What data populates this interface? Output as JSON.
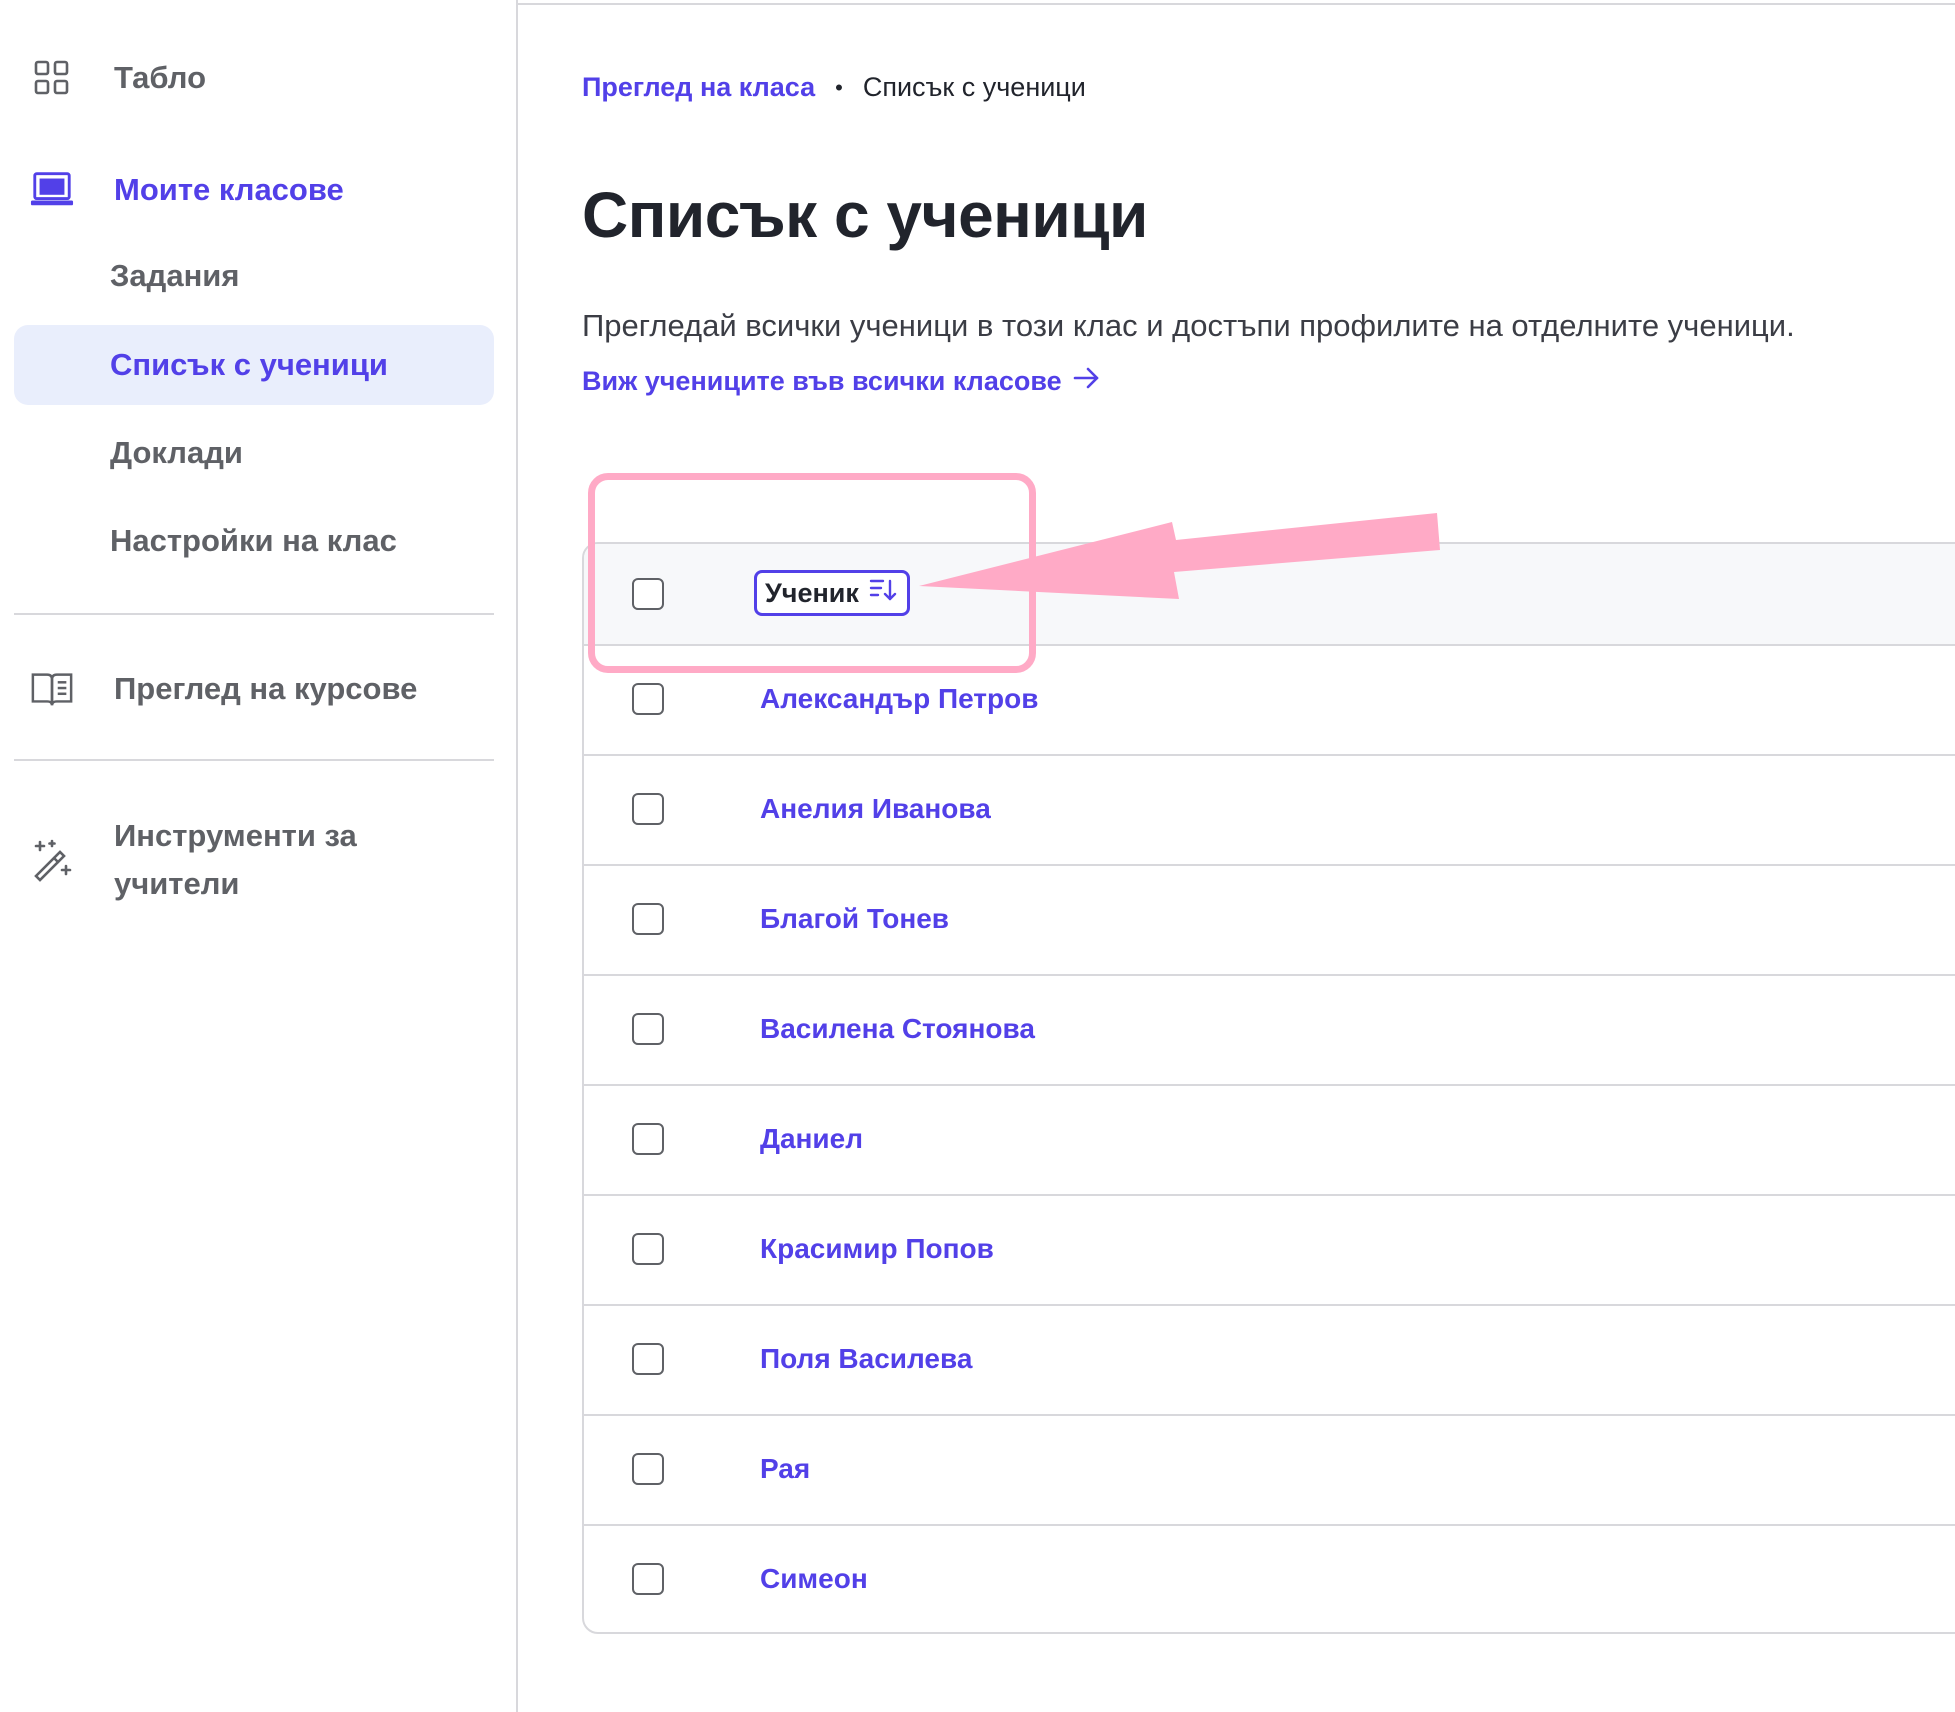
{
  "sidebar": {
    "dashboard": {
      "label": "Табло",
      "icon": "grid-icon"
    },
    "my_classes": {
      "label": "Моите класове",
      "icon": "classroom-icon"
    },
    "class_items": [
      {
        "label": "Задания"
      },
      {
        "label": "Списък с ученици"
      },
      {
        "label": "Доклади"
      },
      {
        "label": "Настройки на клас"
      }
    ],
    "selected_item": "Списък с ученици",
    "courses": {
      "label": "Преглед на курсове",
      "icon": "book-icon"
    },
    "teacher_tools": {
      "label_line1": "Инструменти за",
      "label_line2": "учители",
      "icon": "magic-wand-icon"
    }
  },
  "breadcrumb": {
    "parent": "Преглед на класа",
    "separator": "•",
    "current": "Списък с ученици"
  },
  "page": {
    "title": "Списък с ученици",
    "description": "Прегледай всички ученици в този клас и достъпи профилите на отделните ученици.",
    "all_classes_link": "Виж учениците във всички класове"
  },
  "table": {
    "column_header": "Ученик",
    "sort_icon": "sort-descending-icon",
    "students": [
      "Александър Петров",
      "Анелия Иванова",
      "Благой Тонев",
      "Василена Стоянова",
      "Даниел",
      "Красимир Попов",
      "Поля Василева",
      "Рая",
      "Симеон"
    ]
  },
  "colors": {
    "accent": "#5240e8",
    "selected_bg": "#e9eefc",
    "annotation": "#ffaac6",
    "border": "#d8d8dc"
  }
}
